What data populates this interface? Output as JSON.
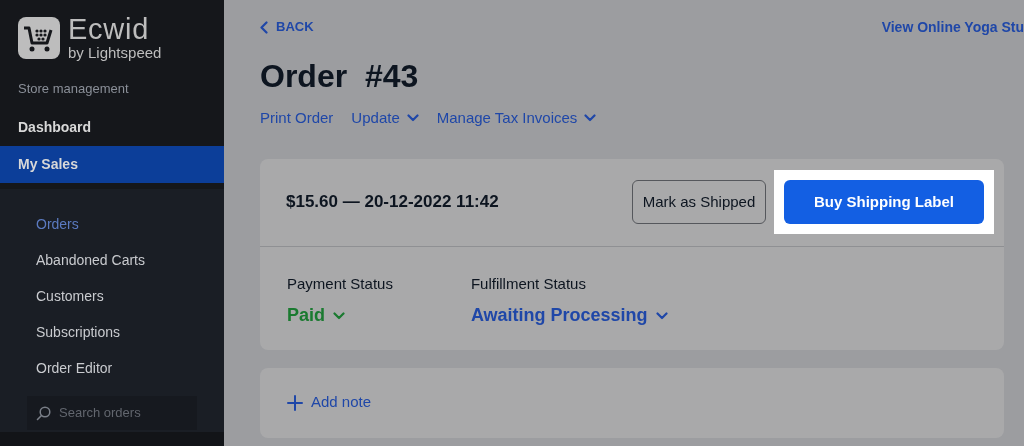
{
  "sidebar": {
    "logo": {
      "name": "Ecwid",
      "tagline": "by Lightspeed"
    },
    "section_label": "Store management",
    "items": [
      {
        "label": "Dashboard",
        "selected": false
      },
      {
        "label": "My Sales",
        "selected": true
      }
    ],
    "sub_items": [
      {
        "label": "Orders",
        "selected": true
      },
      {
        "label": "Abandoned Carts",
        "selected": false
      },
      {
        "label": "Customers",
        "selected": false
      },
      {
        "label": "Subscriptions",
        "selected": false
      },
      {
        "label": "Order Editor",
        "selected": false
      }
    ],
    "search": {
      "placeholder": "Search orders"
    }
  },
  "main": {
    "back": "BACK",
    "view_link": "View Online Yoga Stu",
    "title": "Order  #43",
    "actions": [
      {
        "label": "Print Order",
        "menu": false
      },
      {
        "label": "Update",
        "menu": true
      },
      {
        "label": "Manage Tax Invoices",
        "menu": true
      }
    ],
    "summary": "$15.60 — 20-12-2022 11:42",
    "buttons": [
      {
        "label": "Mark as Shipped",
        "kind": "outline",
        "highlighted": false
      },
      {
        "label": "Buy Shipping Label",
        "kind": "primary",
        "highlighted": true
      }
    ],
    "statuses": [
      {
        "label": "Payment Status",
        "value": "Paid",
        "color": "#1a7a30"
      },
      {
        "label": "Fulfillment Status",
        "value": "Awaiting Processing",
        "color": "#1f47a8"
      }
    ],
    "add_note": "Add note"
  }
}
